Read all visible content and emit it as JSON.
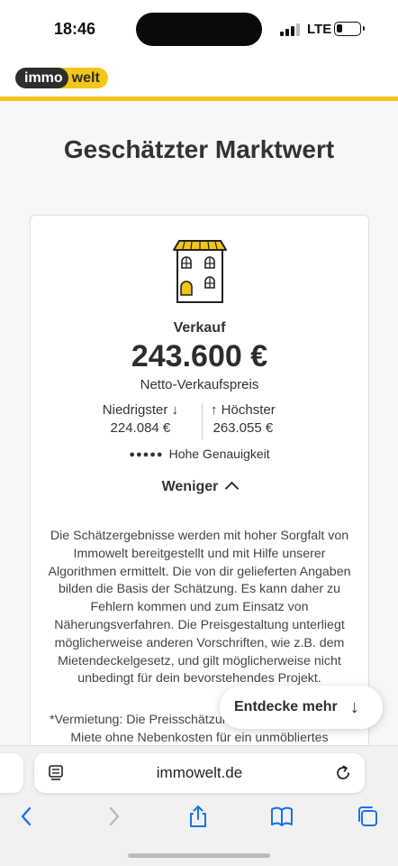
{
  "status": {
    "time": "18:46",
    "network": "LTE",
    "battery_level": 0.25
  },
  "site": {
    "logo_left": "immo",
    "logo_right": "welt",
    "brand_color": "#f5c518"
  },
  "main": {
    "title": "Geschätzter Marktwert"
  },
  "estimate": {
    "category": "Verkauf",
    "price": "243.600 €",
    "price_label": "Netto-Verkaufspreis",
    "lowest_label": "Niedrigster",
    "lowest_arrow": "↓",
    "lowest_value": "224.084 €",
    "highest_label": "Höchster",
    "highest_arrow": "↑",
    "highest_value": "263.055 €",
    "accuracy_dots": "●●●●●",
    "accuracy_label": "Hohe Genauigkeit",
    "accuracy_level": 5,
    "toggle_label": "Weniger",
    "disclaimer": "Die Schätzergebnisse werden mit hoher Sorgfalt von Immowelt bereitgestellt und mit Hilfe unserer Algorithmen ermittelt. Die von dir gelieferten Angaben bilden die Basis der Schätzung. Es kann daher zu Fehlern kommen und zum Einsatz von Näherungsverfahren. Die Preisgestaltung unterliegt möglicherweise anderen Vorschriften, wie z.B. dem Mietendeckelgesetz, und gilt möglicherweise nicht unbedingt für dein bevorstehendes Projekt.",
    "rental_note": "*Vermietung: Die Preisschätzung bezieht sich auf die Miete ohne Nebenkosten für ein unmöbliertes"
  },
  "discover": {
    "label": "Entdecke mehr",
    "arrow": "↓"
  },
  "browser": {
    "url": "immowelt.de",
    "icons": [
      "reader-icon",
      "reload-icon",
      "back-icon",
      "forward-icon",
      "share-icon",
      "bookmarks-icon",
      "tabs-icon"
    ]
  }
}
